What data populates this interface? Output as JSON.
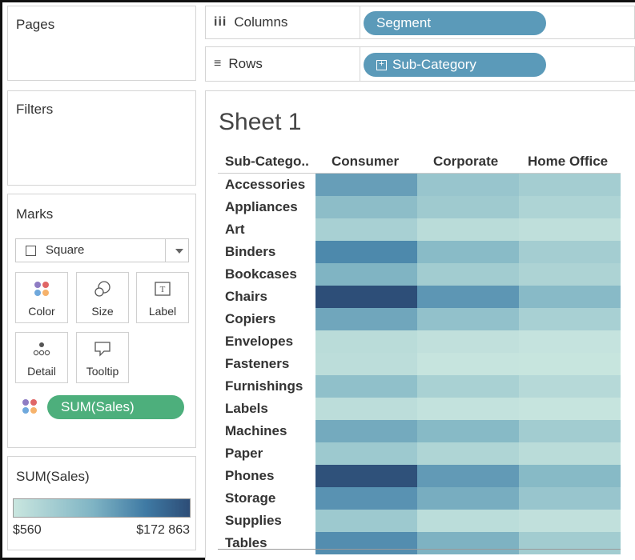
{
  "pages_title": "Pages",
  "filters_title": "Filters",
  "columns": {
    "label": "Columns",
    "pill": "Segment"
  },
  "rows": {
    "label": "Rows",
    "pill": "Sub-Category"
  },
  "marks": {
    "title": "Marks",
    "mark_type": "Square",
    "cards": [
      {
        "label": "Color",
        "icon": "color-dots-icon"
      },
      {
        "label": "Size",
        "icon": "size-icon"
      },
      {
        "label": "Label",
        "icon": "label-icon"
      },
      {
        "label": "Detail",
        "icon": "detail-icon"
      },
      {
        "label": "Tooltip",
        "icon": "tooltip-icon"
      }
    ],
    "field_pill": "SUM(Sales)",
    "pill_color": "#4daf7c"
  },
  "legend": {
    "title": "SUM(Sales)",
    "min_label": "$560",
    "max_label": "$172 863",
    "color_low": "#c9e6df",
    "color_high": "#2d4d77"
  },
  "sheet_title": "Sheet 1",
  "chart_data": {
    "type": "heatmap",
    "row_header": "Sub-Catego..",
    "columns": [
      "Consumer",
      "Corporate",
      "Home Office"
    ],
    "rows": [
      "Accessories",
      "Appliances",
      "Art",
      "Binders",
      "Bookcases",
      "Chairs",
      "Copiers",
      "Envelopes",
      "Fasteners",
      "Furnishings",
      "Labels",
      "Machines",
      "Paper",
      "Phones",
      "Storage",
      "Supplies",
      "Tables"
    ],
    "values": [
      [
        88000,
        45000,
        34000
      ],
      [
        55000,
        38000,
        25000
      ],
      [
        30000,
        14000,
        10000
      ],
      [
        110000,
        58000,
        34000
      ],
      [
        66000,
        36000,
        26000
      ],
      [
        172000,
        96000,
        59000
      ],
      [
        80000,
        50000,
        30000
      ],
      [
        14000,
        8000,
        4000
      ],
      [
        12000,
        3000,
        2000
      ],
      [
        52000,
        29000,
        18000
      ],
      [
        12000,
        6000,
        3000
      ],
      [
        76000,
        60000,
        36000
      ],
      [
        40000,
        24000,
        14000
      ],
      [
        169000,
        92000,
        60000
      ],
      [
        100000,
        73000,
        45000
      ],
      [
        40000,
        13000,
        8000
      ],
      [
        105000,
        68000,
        36000
      ]
    ],
    "value_range": [
      560,
      172863
    ],
    "color_low": "#c9e6df",
    "color_high": "#2d4d77"
  }
}
